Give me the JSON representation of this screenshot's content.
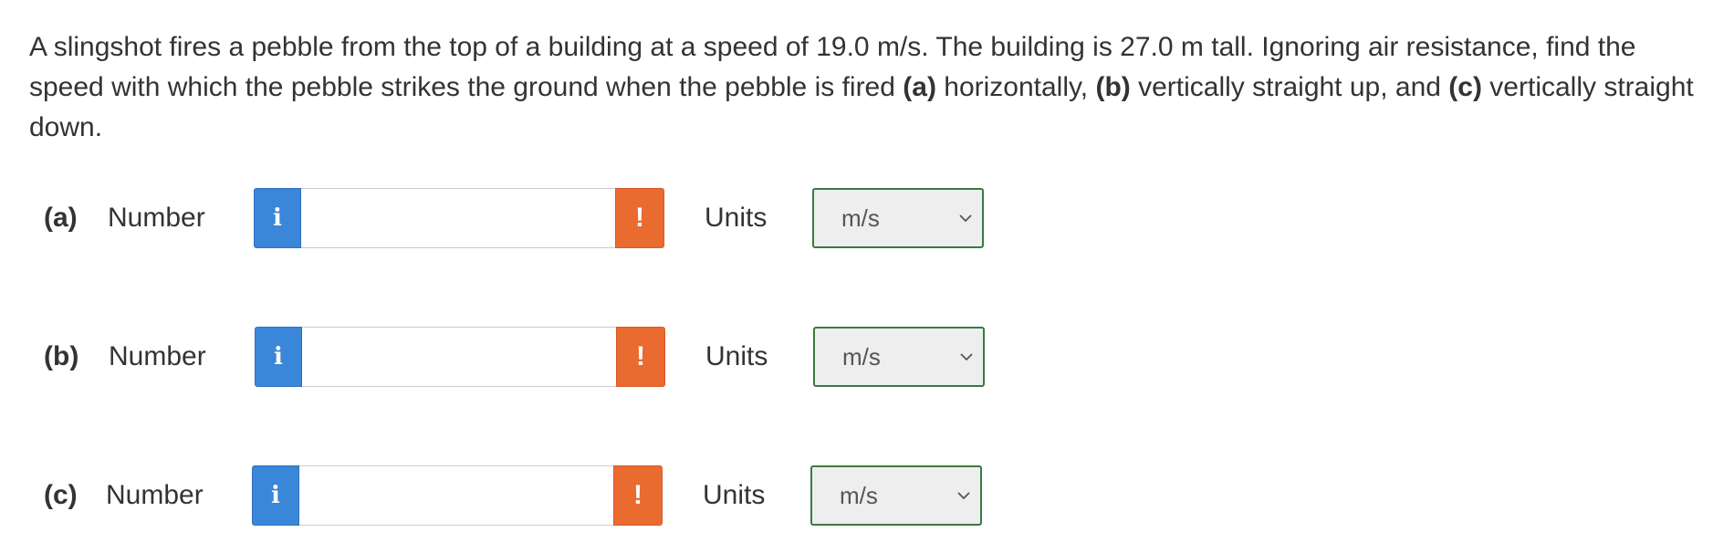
{
  "question": {
    "seg1": "A slingshot fires a pebble from the top of a building at a speed of 19.0 m/s. The building is 27.0 m tall. Ignoring air resistance, find the speed with which the pebble strikes the ground when the pebble is fired ",
    "part_a": "(a)",
    "seg2": " horizontally, ",
    "part_b": "(b)",
    "seg3": " vertically straight up, and ",
    "part_c": "(c)",
    "seg4": " vertically straight down."
  },
  "parts": [
    {
      "label": "(a)",
      "number_label": "Number",
      "info_icon": "i",
      "value": "",
      "warning_icon": "!",
      "units_label": "Units",
      "unit": "m/s"
    },
    {
      "label": "(b)",
      "number_label": "Number",
      "info_icon": "i",
      "value": "",
      "warning_icon": "!",
      "units_label": "Units",
      "unit": "m/s"
    },
    {
      "label": "(c)",
      "number_label": "Number",
      "info_icon": "i",
      "value": "",
      "warning_icon": "!",
      "units_label": "Units",
      "unit": "m/s"
    }
  ],
  "colors": {
    "info_button": "#3a86d9",
    "warning_icon": "#ea6b2f",
    "select_border": "#3b7a3e",
    "select_background": "#eeeeee"
  }
}
